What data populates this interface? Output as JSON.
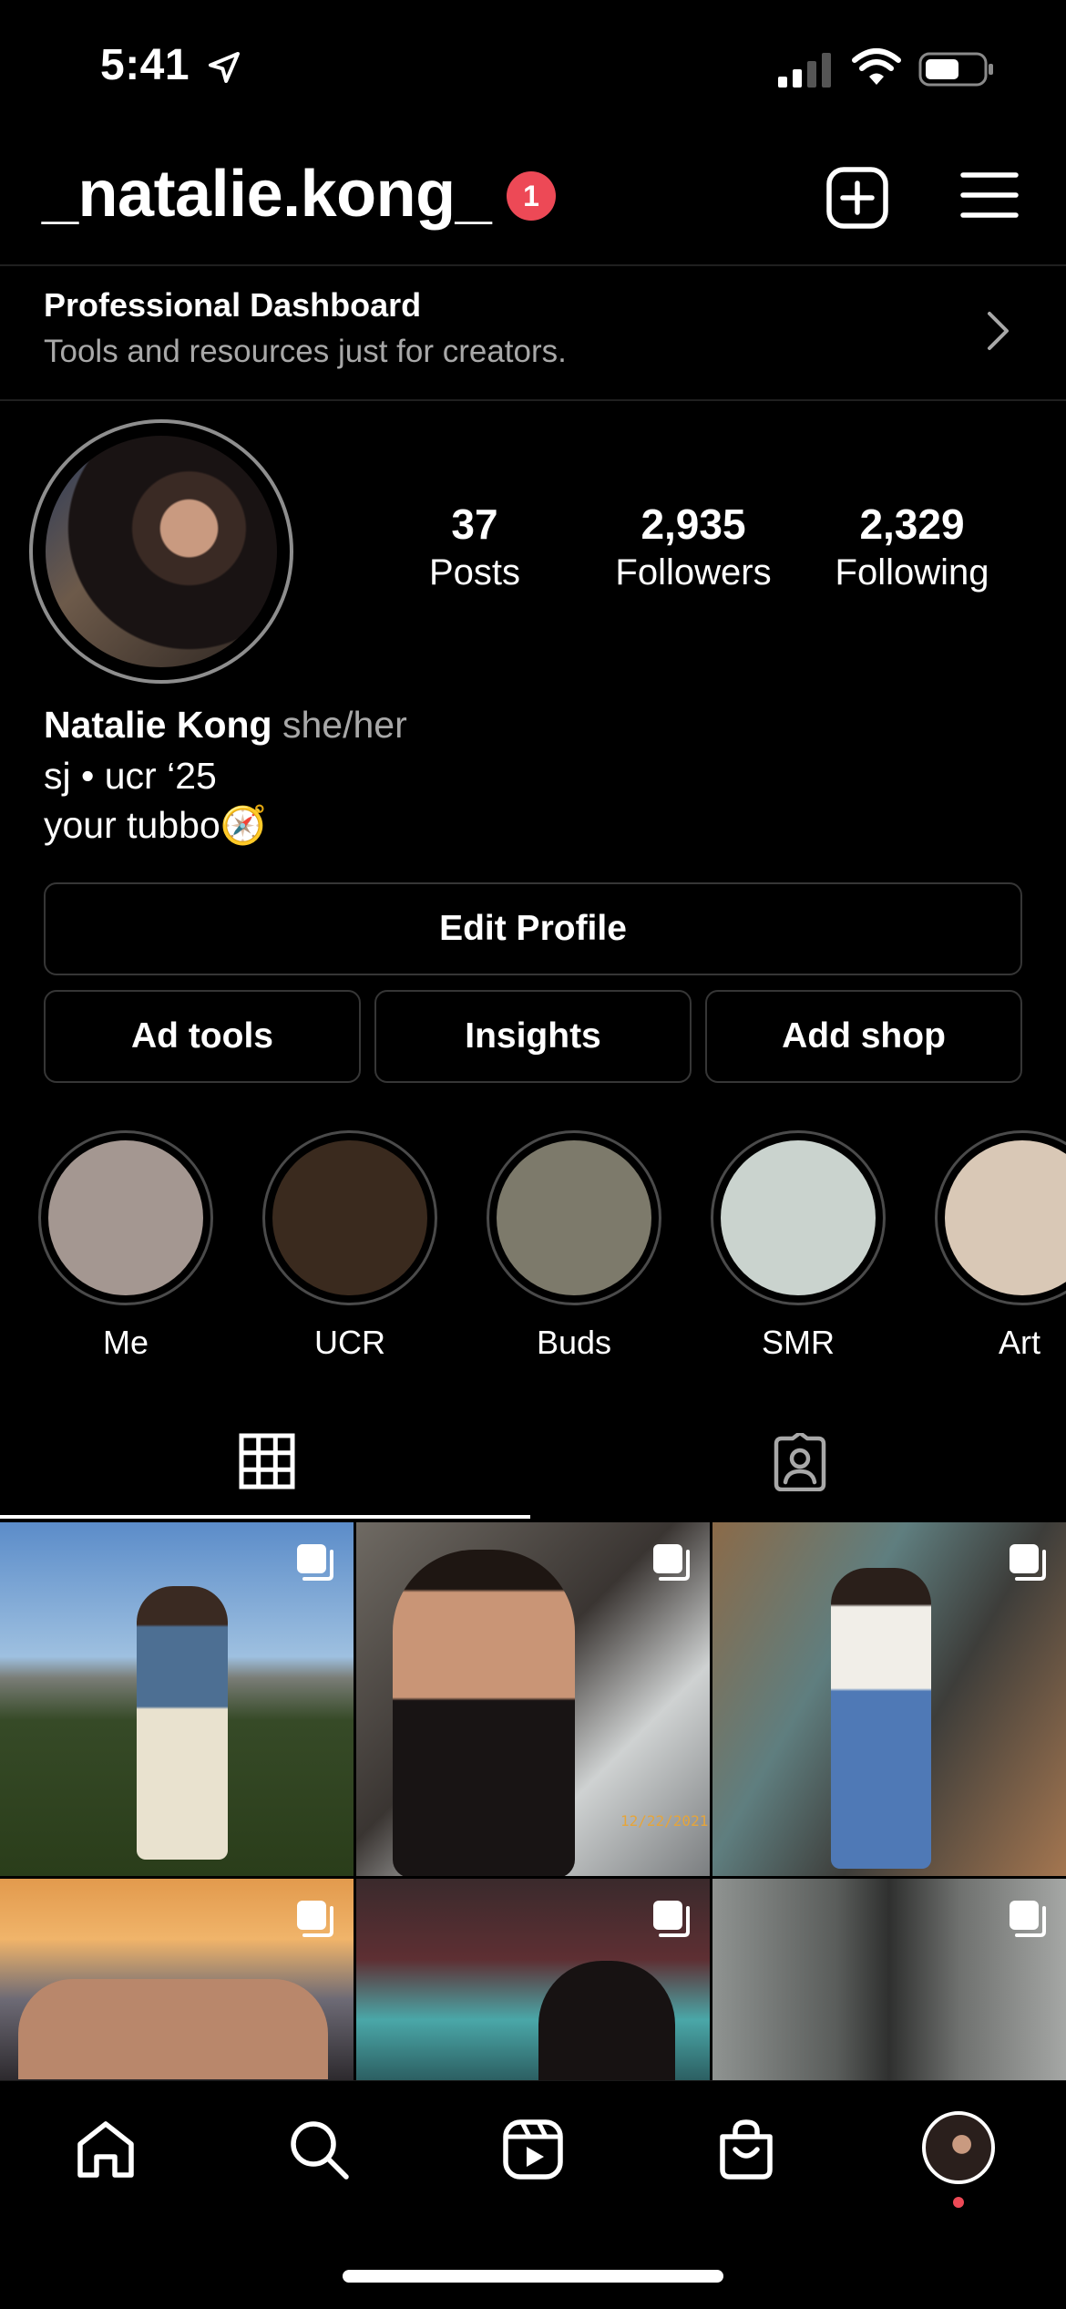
{
  "status_bar": {
    "time": "5:41"
  },
  "header": {
    "username": "_natalie.kong_",
    "notification_count": "1"
  },
  "dashboard": {
    "title": "Professional Dashboard",
    "subtitle": "Tools and resources just for creators."
  },
  "stats": [
    {
      "value": "37",
      "label": "Posts"
    },
    {
      "value": "2,935",
      "label": "Followers"
    },
    {
      "value": "2,329",
      "label": "Following"
    }
  ],
  "bio": {
    "name": "Natalie Kong",
    "pronouns": "she/her",
    "line1": "sj • ucr ‘25",
    "line2": "your tubbo",
    "line2_emoji": "🧭"
  },
  "buttons": {
    "edit_profile": "Edit Profile",
    "ad_tools": "Ad tools",
    "insights": "Insights",
    "add_shop": "Add shop"
  },
  "highlights": [
    {
      "label": "Me",
      "color": "#a49791"
    },
    {
      "label": "UCR",
      "color": "#3a2a1e"
    },
    {
      "label": "Buds",
      "color": "#7d7a6b"
    },
    {
      "label": "SMR",
      "color": "#cad3ce"
    },
    {
      "label": "Art",
      "color": "#d9c8b6"
    }
  ],
  "tabs": [
    {
      "name": "posts-grid",
      "icon": "grid-icon",
      "active": true
    },
    {
      "name": "tagged",
      "icon": "tagged-person-icon",
      "active": false
    }
  ],
  "posts": [
    {
      "description_icon": "carousel-icon",
      "date_stamp": ""
    },
    {
      "description_icon": "carousel-icon",
      "date_stamp": "12/22/2021"
    },
    {
      "description_icon": "carousel-icon",
      "date_stamp": ""
    },
    {
      "description_icon": "carousel-icon",
      "date_stamp": ""
    },
    {
      "description_icon": "carousel-icon",
      "date_stamp": ""
    },
    {
      "description_icon": "carousel-icon",
      "date_stamp": ""
    }
  ],
  "bottom_nav": [
    {
      "name": "home",
      "icon": "home-icon"
    },
    {
      "name": "search",
      "icon": "search-icon"
    },
    {
      "name": "reels",
      "icon": "reels-icon"
    },
    {
      "name": "shop",
      "icon": "shopping-bag-icon"
    },
    {
      "name": "profile",
      "icon": "profile-avatar-icon"
    }
  ],
  "colors": {
    "accent_red": "#ed4956",
    "secondary_text": "#a8a8a8",
    "border": "#363636"
  }
}
